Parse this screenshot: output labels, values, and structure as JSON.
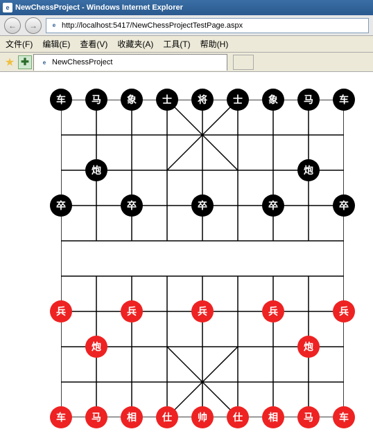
{
  "title": "NewChessProject - Windows Internet Explorer",
  "url": "http://localhost:5417/NewChessProjectTestPage.aspx",
  "menu": {
    "file": "文件(F)",
    "edit": "编辑(E)",
    "view": "查看(V)",
    "fav": "收藏夹(A)",
    "tools": "工具(T)",
    "help": "帮助(H)"
  },
  "tab": {
    "title": "NewChessProject"
  },
  "board": {
    "cols": 9,
    "rows": 10,
    "cell": 51,
    "pieces": [
      {
        "row": 0,
        "col": 0,
        "side": "black",
        "label": "车"
      },
      {
        "row": 0,
        "col": 1,
        "side": "black",
        "label": "马"
      },
      {
        "row": 0,
        "col": 2,
        "side": "black",
        "label": "象"
      },
      {
        "row": 0,
        "col": 3,
        "side": "black",
        "label": "士"
      },
      {
        "row": 0,
        "col": 4,
        "side": "black",
        "label": "将"
      },
      {
        "row": 0,
        "col": 5,
        "side": "black",
        "label": "士"
      },
      {
        "row": 0,
        "col": 6,
        "side": "black",
        "label": "象"
      },
      {
        "row": 0,
        "col": 7,
        "side": "black",
        "label": "马"
      },
      {
        "row": 0,
        "col": 8,
        "side": "black",
        "label": "车"
      },
      {
        "row": 2,
        "col": 1,
        "side": "black",
        "label": "炮"
      },
      {
        "row": 2,
        "col": 7,
        "side": "black",
        "label": "炮"
      },
      {
        "row": 3,
        "col": 0,
        "side": "black",
        "label": "卒"
      },
      {
        "row": 3,
        "col": 2,
        "side": "black",
        "label": "卒"
      },
      {
        "row": 3,
        "col": 4,
        "side": "black",
        "label": "卒"
      },
      {
        "row": 3,
        "col": 6,
        "side": "black",
        "label": "卒"
      },
      {
        "row": 3,
        "col": 8,
        "side": "black",
        "label": "卒"
      },
      {
        "row": 6,
        "col": 0,
        "side": "red",
        "label": "兵"
      },
      {
        "row": 6,
        "col": 2,
        "side": "red",
        "label": "兵"
      },
      {
        "row": 6,
        "col": 4,
        "side": "red",
        "label": "兵"
      },
      {
        "row": 6,
        "col": 6,
        "side": "red",
        "label": "兵"
      },
      {
        "row": 6,
        "col": 8,
        "side": "red",
        "label": "兵"
      },
      {
        "row": 7,
        "col": 1,
        "side": "red",
        "label": "炮"
      },
      {
        "row": 7,
        "col": 7,
        "side": "red",
        "label": "炮"
      },
      {
        "row": 9,
        "col": 0,
        "side": "red",
        "label": "车"
      },
      {
        "row": 9,
        "col": 1,
        "side": "red",
        "label": "马"
      },
      {
        "row": 9,
        "col": 2,
        "side": "red",
        "label": "相"
      },
      {
        "row": 9,
        "col": 3,
        "side": "red",
        "label": "仕"
      },
      {
        "row": 9,
        "col": 4,
        "side": "red",
        "label": "帅"
      },
      {
        "row": 9,
        "col": 5,
        "side": "red",
        "label": "仕"
      },
      {
        "row": 9,
        "col": 6,
        "side": "red",
        "label": "相"
      },
      {
        "row": 9,
        "col": 7,
        "side": "red",
        "label": "马"
      },
      {
        "row": 9,
        "col": 8,
        "side": "red",
        "label": "车"
      }
    ]
  }
}
